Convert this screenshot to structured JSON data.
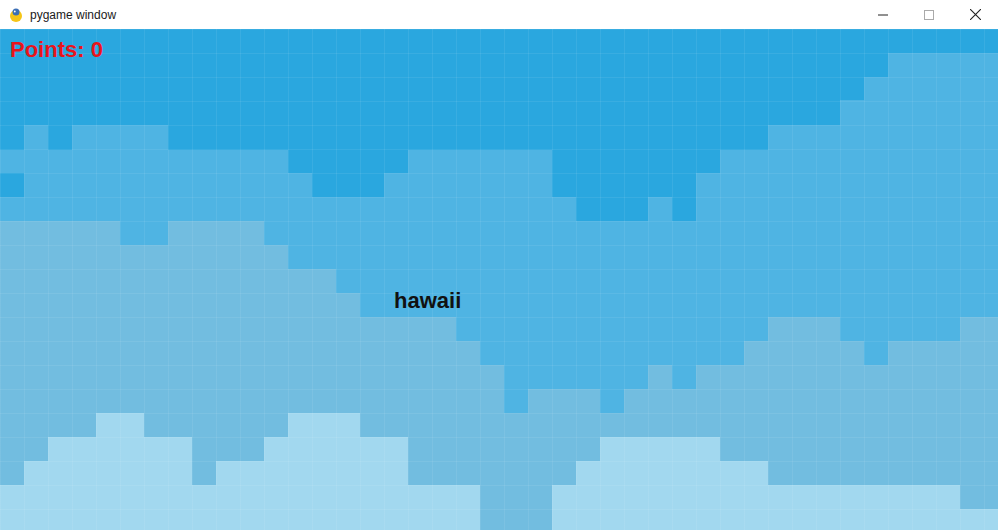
{
  "window": {
    "title": "pygame window"
  },
  "hud": {
    "points": "Points: 0"
  },
  "word": {
    "text": "hawaii"
  }
}
